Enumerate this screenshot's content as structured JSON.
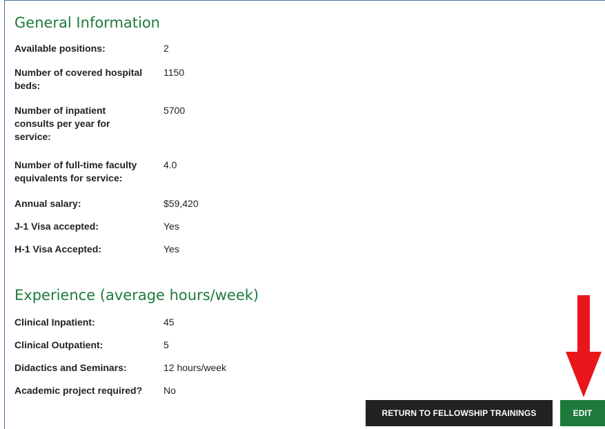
{
  "general": {
    "title": "General Information",
    "rows": [
      {
        "label": "Available positions:",
        "value": "2"
      },
      {
        "label": "Number of covered hospital beds:",
        "value": "1150"
      },
      {
        "label": "Number of inpatient consults per year for service:",
        "value": "5700"
      },
      {
        "label": "Number of full-time faculty equivalents for service:",
        "value": "4.0"
      },
      {
        "label": "Annual salary:",
        "value": "$59,420"
      },
      {
        "label": "J-1 Visa accepted:",
        "value": "Yes"
      },
      {
        "label": "H-1 Visa Accepted:",
        "value": "Yes"
      }
    ]
  },
  "experience": {
    "title": "Experience (average hours/week)",
    "rows": [
      {
        "label": "Clinical Inpatient:",
        "value": "45"
      },
      {
        "label": "Clinical Outpatient:",
        "value": "5"
      },
      {
        "label": "Didactics and Seminars:",
        "value": "12 hours/week"
      },
      {
        "label": "Academic project required?",
        "value": "No"
      }
    ]
  },
  "actions": {
    "return_label": "RETURN TO FELLOWSHIP TRAININGS",
    "edit_label": "EDIT"
  },
  "colors": {
    "heading_green": "#1e7a3c",
    "edit_button": "#1e7a3c",
    "return_button": "#222222",
    "annotation_arrow": "#e8161b"
  },
  "annotation": {
    "icon": "down-arrow-icon"
  }
}
